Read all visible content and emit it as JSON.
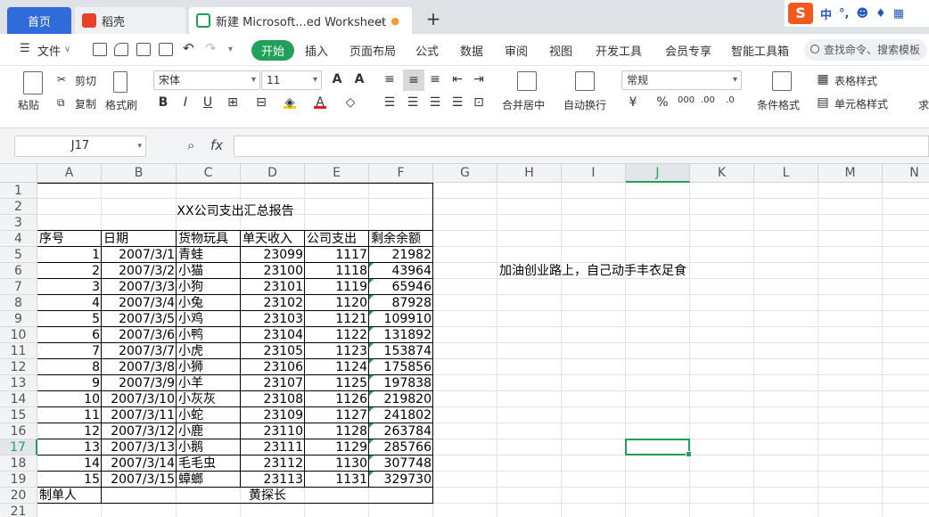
{
  "tabs": {
    "home": "首页",
    "daoke": "稻壳",
    "file": "新建 Microsoft...ed Worksheet",
    "new": "+"
  },
  "ime": {
    "mode": "中",
    "punct": "°,"
  },
  "menu": {
    "file": "文件",
    "items": [
      "开始",
      "插入",
      "页面布局",
      "公式",
      "数据",
      "审阅",
      "视图",
      "开发工具",
      "会员专享",
      "智能工具箱"
    ],
    "search": "查找命令、搜索模板"
  },
  "ribbon": {
    "paste": "粘贴",
    "cut": "剪切",
    "copy": "复制",
    "format_painter": "格式刷",
    "font_name": "宋体",
    "font_size": "11",
    "merge": "合并居中",
    "wrap": "自动换行",
    "number_format": "常规",
    "cond_format": "条件格式",
    "table_style": "表格样式",
    "cell_style": "单元格样式",
    "find": "求"
  },
  "formula_bar": {
    "name_box": "J17",
    "fx": "fx",
    "value": ""
  },
  "columns": [
    "A",
    "B",
    "C",
    "D",
    "E",
    "F",
    "G",
    "H",
    "I",
    "J",
    "K",
    "L",
    "M",
    "N"
  ],
  "rows": [
    "1",
    "2",
    "3",
    "4",
    "5",
    "6",
    "7",
    "8",
    "9",
    "10",
    "11",
    "12",
    "13",
    "14",
    "15",
    "16",
    "17",
    "18",
    "19",
    "20",
    "21"
  ],
  "sheet": {
    "title": "XX公司支出汇总报告",
    "headers": [
      "序号",
      "日期",
      "货物玩具",
      "单天收入",
      "公司支出",
      "剩余余额"
    ],
    "data": [
      [
        "1",
        "2007/3/1",
        "青蛙",
        "23099",
        "1117",
        "21982"
      ],
      [
        "2",
        "2007/3/2",
        "小猫",
        "23100",
        "1118",
        "43964"
      ],
      [
        "3",
        "2007/3/3",
        "小狗",
        "23101",
        "1119",
        "65946"
      ],
      [
        "4",
        "2007/3/4",
        "小兔",
        "23102",
        "1120",
        "87928"
      ],
      [
        "5",
        "2007/3/5",
        "小鸡",
        "23103",
        "1121",
        "109910"
      ],
      [
        "6",
        "2007/3/6",
        "小鸭",
        "23104",
        "1122",
        "131892"
      ],
      [
        "7",
        "2007/3/7",
        "小虎",
        "23105",
        "1123",
        "153874"
      ],
      [
        "8",
        "2007/3/8",
        "小狮",
        "23106",
        "1124",
        "175856"
      ],
      [
        "9",
        "2007/3/9",
        "小羊",
        "23107",
        "1125",
        "197838"
      ],
      [
        "10",
        "2007/3/10",
        "小灰灰",
        "23108",
        "1126",
        "219820"
      ],
      [
        "11",
        "2007/3/11",
        "小蛇",
        "23109",
        "1127",
        "241802"
      ],
      [
        "12",
        "2007/3/12",
        "小鹿",
        "23110",
        "1128",
        "263784"
      ],
      [
        "13",
        "2007/3/13",
        "小鹅",
        "23111",
        "1129",
        "285766"
      ],
      [
        "14",
        "2007/3/14",
        "毛毛虫",
        "23112",
        "1130",
        "307748"
      ],
      [
        "15",
        "2007/3/15",
        "蟑螂",
        "23113",
        "1131",
        "329730"
      ]
    ],
    "footer_label": "制单人",
    "footer_name": "黄探长",
    "note": "加油创业路上，自己动手丰衣足食",
    "selected_cell": "J17"
  }
}
